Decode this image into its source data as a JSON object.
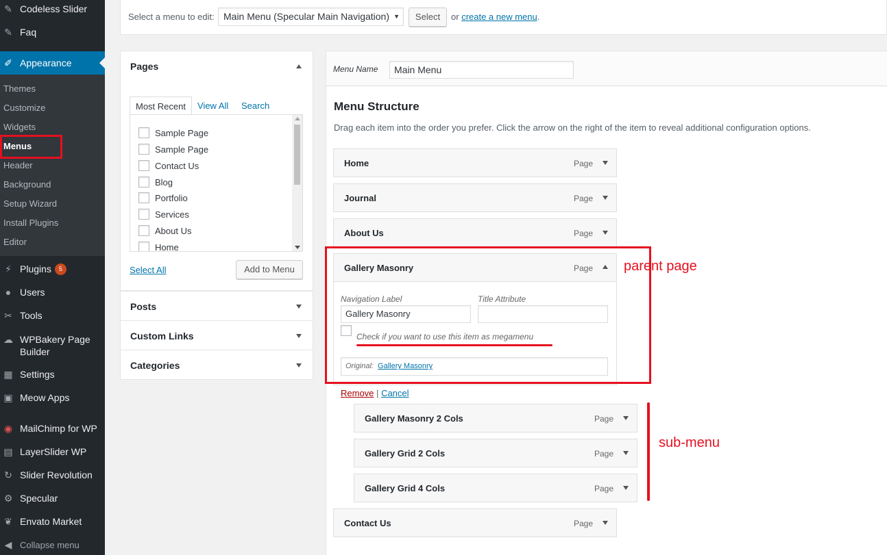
{
  "sidebar": {
    "top_items": [
      {
        "label": "Codeless Slider",
        "icon": "pin-icon"
      },
      {
        "label": "Faq",
        "icon": "pin-icon"
      }
    ],
    "appearance": {
      "label": "Appearance",
      "icon": "brush-icon"
    },
    "appearance_submenu": [
      "Themes",
      "Customize",
      "Widgets",
      "Menus",
      "Header",
      "Background",
      "Setup Wizard",
      "Install Plugins",
      "Editor"
    ],
    "main_items": [
      {
        "label": "Plugins",
        "badge": "5",
        "icon": "plugin-icon"
      },
      {
        "label": "Users",
        "icon": "users-icon"
      },
      {
        "label": "Tools",
        "icon": "wrench-icon"
      },
      {
        "label": "WPBakery Page Builder",
        "icon": "cloud-icon"
      },
      {
        "label": "Settings",
        "icon": "settings-icon"
      },
      {
        "label": "Meow Apps",
        "icon": "camera-icon"
      },
      {
        "label": "MailChimp for WP",
        "icon": "mailchimp-icon"
      },
      {
        "label": "LayerSlider WP",
        "icon": "layers-icon"
      },
      {
        "label": "Slider Revolution",
        "icon": "refresh-icon"
      },
      {
        "label": "Specular",
        "icon": "gear-icon"
      },
      {
        "label": "Envato Market",
        "icon": "leaf-icon"
      }
    ],
    "collapse_label": "Collapse menu"
  },
  "topbar": {
    "select_label": "Select a menu to edit:",
    "selected_menu": "Main Menu (Specular Main Navigation)",
    "select_button": "Select",
    "or_text": "or",
    "create_link": "create a new menu",
    "period": "."
  },
  "left": {
    "pages_title": "Pages",
    "tabs": [
      "Most Recent",
      "View All",
      "Search"
    ],
    "pages": [
      "Sample Page",
      "Sample Page",
      "Contact Us",
      "Blog",
      "Portfolio",
      "Services",
      "About Us",
      "Home"
    ],
    "select_all": "Select All",
    "add_to_menu": "Add to Menu",
    "posts_title": "Posts",
    "custom_links_title": "Custom Links",
    "categories_title": "Categories"
  },
  "right": {
    "menu_name_label": "Menu Name",
    "menu_name_value": "Main Menu",
    "structure_title": "Menu Structure",
    "structure_desc": "Drag each item into the order you prefer. Click the arrow on the right of the item to reveal additional configuration options.",
    "items": [
      {
        "title": "Home",
        "type": "Page"
      },
      {
        "title": "Journal",
        "type": "Page"
      },
      {
        "title": "About Us",
        "type": "Page"
      },
      {
        "title": "Gallery Masonry",
        "type": "Page"
      }
    ],
    "expanded": {
      "nav_label_label": "Navigation Label",
      "nav_label_value": "Gallery Masonry",
      "title_attr_label": "Title Attribute",
      "title_attr_value": "",
      "megamenu_label": "Check if you want to use this item as megamenu",
      "original_label": "Original:",
      "original_link": "Gallery Masonry",
      "remove": "Remove",
      "separator": "|",
      "cancel": "Cancel"
    },
    "sub_items": [
      {
        "title": "Gallery Masonry 2 Cols",
        "type": "Page"
      },
      {
        "title": "Gallery Grid 2 Cols",
        "type": "Page"
      },
      {
        "title": "Gallery Grid 4 Cols",
        "type": "Page"
      }
    ],
    "last_item": {
      "title": "Contact Us",
      "type": "Page"
    }
  },
  "annotations": {
    "parent_page": "parent page",
    "sub_menu": "sub-menu",
    "color": "#e5101f"
  }
}
